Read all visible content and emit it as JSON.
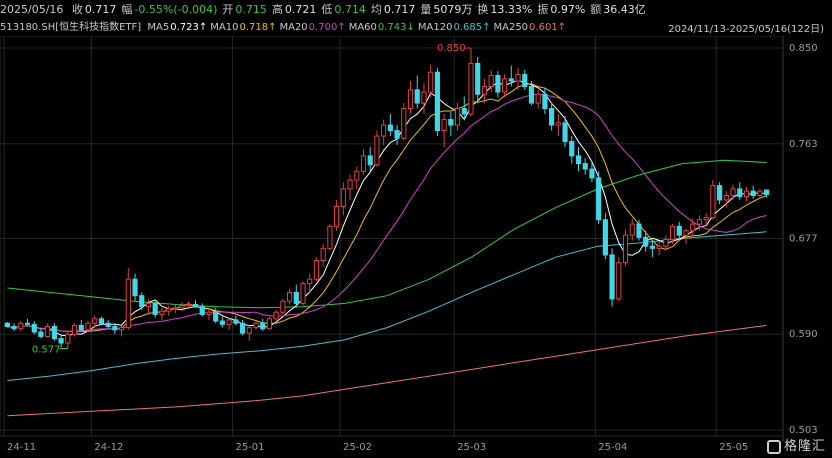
{
  "header": {
    "date": "2025/05/16",
    "items": [
      {
        "label": "收",
        "value": "0.717",
        "color": "#e0e0e0"
      },
      {
        "label": "幅",
        "value": "-0.55%(-0.004)",
        "color": "#2ecc40"
      },
      {
        "label": "开",
        "value": "0.715",
        "color": "#2ecc40"
      },
      {
        "label": "高",
        "value": "0.721",
        "color": "#e0e0e0"
      },
      {
        "label": "低",
        "value": "0.714",
        "color": "#2ecc40"
      },
      {
        "label": "均",
        "value": "0.717",
        "color": "#e0e0e0"
      },
      {
        "label": "量",
        "value": "5079万",
        "color": "#e0e0e0"
      },
      {
        "label": "换",
        "value": "13.33%",
        "color": "#e0e0e0"
      },
      {
        "label": "振",
        "value": "0.97%",
        "color": "#e0e0e0"
      },
      {
        "label": "额",
        "value": "36.43亿",
        "color": "#e0e0e0"
      }
    ]
  },
  "ma_bar": {
    "security": "513180.SH[恒生科技指数ETF]",
    "period": "2024/11/13-2025/05/16(122日)",
    "items": [
      {
        "label": "MA5",
        "value": "0.723↑",
        "color": "#ffffff"
      },
      {
        "label": "MA10",
        "value": "0.718↑",
        "color": "#f0c000"
      },
      {
        "label": "MA20",
        "value": "0.700↑",
        "color": "#d040d0"
      },
      {
        "label": "MA60",
        "value": "0.743↓",
        "color": "#2ecc40"
      },
      {
        "label": "MA120",
        "value": "0.685↑",
        "color": "#40c0d0"
      },
      {
        "label": "MA250",
        "value": "0.601↑",
        "color": "#f07070"
      }
    ]
  },
  "logo": {
    "text": "格隆汇"
  },
  "chart_data": {
    "type": "candlestick",
    "y_ticks": [
      "0.850",
      "0.763",
      "0.677",
      "0.590",
      "0.503"
    ],
    "ylim": [
      0.503,
      0.85
    ],
    "x_ticks": [
      {
        "label": "24-11",
        "i": 0
      },
      {
        "label": "24-12",
        "i": 13
      },
      {
        "label": "25-01",
        "i": 34
      },
      {
        "label": "25-02",
        "i": 50
      },
      {
        "label": "25-03",
        "i": 67
      },
      {
        "label": "25-04",
        "i": 88
      },
      {
        "label": "25-05",
        "i": 106
      }
    ],
    "annotations": [
      {
        "text": "0.850",
        "i": 69,
        "value": 0.85
      },
      {
        "text": "0.577",
        "i": 9,
        "value": 0.577
      }
    ],
    "ohlc": [
      [
        0.6,
        0.601,
        0.596,
        0.597
      ],
      [
        0.597,
        0.6,
        0.593,
        0.595
      ],
      [
        0.595,
        0.602,
        0.593,
        0.6
      ],
      [
        0.6,
        0.604,
        0.597,
        0.599
      ],
      [
        0.599,
        0.602,
        0.59,
        0.592
      ],
      [
        0.592,
        0.596,
        0.586,
        0.588
      ],
      [
        0.588,
        0.6,
        0.587,
        0.597
      ],
      [
        0.597,
        0.6,
        0.584,
        0.586
      ],
      [
        0.586,
        0.59,
        0.578,
        0.582
      ],
      [
        0.582,
        0.592,
        0.577,
        0.59
      ],
      [
        0.59,
        0.6,
        0.588,
        0.598
      ],
      [
        0.598,
        0.603,
        0.592,
        0.594
      ],
      [
        0.594,
        0.602,
        0.592,
        0.6
      ],
      [
        0.6,
        0.607,
        0.596,
        0.604
      ],
      [
        0.604,
        0.606,
        0.598,
        0.6
      ],
      [
        0.6,
        0.603,
        0.595,
        0.597
      ],
      [
        0.597,
        0.6,
        0.59,
        0.594
      ],
      [
        0.594,
        0.598,
        0.588,
        0.596
      ],
      [
        0.596,
        0.65,
        0.594,
        0.64
      ],
      [
        0.64,
        0.645,
        0.62,
        0.625
      ],
      [
        0.625,
        0.628,
        0.612,
        0.615
      ],
      [
        0.615,
        0.622,
        0.608,
        0.618
      ],
      [
        0.618,
        0.62,
        0.605,
        0.608
      ],
      [
        0.608,
        0.614,
        0.603,
        0.611
      ],
      [
        0.611,
        0.616,
        0.607,
        0.613
      ],
      [
        0.613,
        0.617,
        0.609,
        0.614
      ],
      [
        0.614,
        0.619,
        0.611,
        0.616
      ],
      [
        0.616,
        0.62,
        0.613,
        0.617
      ],
      [
        0.617,
        0.621,
        0.614,
        0.615
      ],
      [
        0.615,
        0.618,
        0.606,
        0.608
      ],
      [
        0.608,
        0.613,
        0.603,
        0.61
      ],
      [
        0.61,
        0.614,
        0.6,
        0.602
      ],
      [
        0.602,
        0.606,
        0.596,
        0.599
      ],
      [
        0.599,
        0.605,
        0.594,
        0.603
      ],
      [
        0.603,
        0.607,
        0.598,
        0.6
      ],
      [
        0.6,
        0.603,
        0.589,
        0.591
      ],
      [
        0.591,
        0.598,
        0.584,
        0.596
      ],
      [
        0.596,
        0.602,
        0.594,
        0.6
      ],
      [
        0.6,
        0.604,
        0.593,
        0.595
      ],
      [
        0.595,
        0.606,
        0.594,
        0.604
      ],
      [
        0.604,
        0.612,
        0.601,
        0.61
      ],
      [
        0.61,
        0.622,
        0.608,
        0.62
      ],
      [
        0.62,
        0.631,
        0.617,
        0.628
      ],
      [
        0.628,
        0.635,
        0.614,
        0.618
      ],
      [
        0.618,
        0.638,
        0.616,
        0.636
      ],
      [
        0.636,
        0.645,
        0.628,
        0.64
      ],
      [
        0.64,
        0.66,
        0.638,
        0.657
      ],
      [
        0.657,
        0.672,
        0.652,
        0.668
      ],
      [
        0.668,
        0.69,
        0.666,
        0.688
      ],
      [
        0.688,
        0.712,
        0.684,
        0.706
      ],
      [
        0.706,
        0.728,
        0.698,
        0.722
      ],
      [
        0.722,
        0.735,
        0.712,
        0.73
      ],
      [
        0.73,
        0.742,
        0.722,
        0.738
      ],
      [
        0.738,
        0.758,
        0.735,
        0.752
      ],
      [
        0.752,
        0.76,
        0.738,
        0.744
      ],
      [
        0.744,
        0.775,
        0.742,
        0.77
      ],
      [
        0.77,
        0.785,
        0.762,
        0.78
      ],
      [
        0.78,
        0.79,
        0.77,
        0.775
      ],
      [
        0.775,
        0.78,
        0.762,
        0.768
      ],
      [
        0.768,
        0.8,
        0.766,
        0.795
      ],
      [
        0.795,
        0.82,
        0.79,
        0.812
      ],
      [
        0.812,
        0.825,
        0.795,
        0.8
      ],
      [
        0.8,
        0.818,
        0.79,
        0.81
      ],
      [
        0.81,
        0.835,
        0.805,
        0.828
      ],
      [
        0.828,
        0.832,
        0.77,
        0.775
      ],
      [
        0.775,
        0.79,
        0.76,
        0.785
      ],
      [
        0.785,
        0.792,
        0.77,
        0.78
      ],
      [
        0.78,
        0.8,
        0.775,
        0.795
      ],
      [
        0.795,
        0.806,
        0.785,
        0.79
      ],
      [
        0.79,
        0.85,
        0.788,
        0.836
      ],
      [
        0.836,
        0.842,
        0.8,
        0.808
      ],
      [
        0.808,
        0.822,
        0.8,
        0.815
      ],
      [
        0.815,
        0.83,
        0.81,
        0.825
      ],
      [
        0.825,
        0.829,
        0.805,
        0.81
      ],
      [
        0.81,
        0.826,
        0.805,
        0.822
      ],
      [
        0.822,
        0.834,
        0.815,
        0.82
      ],
      [
        0.82,
        0.832,
        0.812,
        0.826
      ],
      [
        0.826,
        0.83,
        0.812,
        0.815
      ],
      [
        0.815,
        0.82,
        0.798,
        0.8
      ],
      [
        0.8,
        0.812,
        0.795,
        0.808
      ],
      [
        0.808,
        0.814,
        0.79,
        0.795
      ],
      [
        0.795,
        0.8,
        0.775,
        0.78
      ],
      [
        0.78,
        0.79,
        0.77,
        0.782
      ],
      [
        0.782,
        0.788,
        0.76,
        0.765
      ],
      [
        0.765,
        0.77,
        0.745,
        0.752
      ],
      [
        0.752,
        0.76,
        0.738,
        0.745
      ],
      [
        0.745,
        0.75,
        0.735,
        0.74
      ],
      [
        0.74,
        0.746,
        0.728,
        0.732
      ],
      [
        0.732,
        0.738,
        0.69,
        0.694
      ],
      [
        0.694,
        0.7,
        0.658,
        0.662
      ],
      [
        0.662,
        0.668,
        0.615,
        0.622
      ],
      [
        0.622,
        0.66,
        0.62,
        0.655
      ],
      [
        0.655,
        0.685,
        0.652,
        0.68
      ],
      [
        0.68,
        0.695,
        0.675,
        0.69
      ],
      [
        0.69,
        0.694,
        0.675,
        0.678
      ],
      [
        0.678,
        0.684,
        0.665,
        0.67
      ],
      [
        0.67,
        0.676,
        0.66,
        0.668
      ],
      [
        0.668,
        0.674,
        0.662,
        0.67
      ],
      [
        0.67,
        0.68,
        0.666,
        0.676
      ],
      [
        0.676,
        0.69,
        0.672,
        0.688
      ],
      [
        0.688,
        0.692,
        0.676,
        0.68
      ],
      [
        0.68,
        0.686,
        0.672,
        0.684
      ],
      [
        0.684,
        0.695,
        0.68,
        0.69
      ],
      [
        0.69,
        0.698,
        0.684,
        0.694
      ],
      [
        0.694,
        0.7,
        0.688,
        0.696
      ],
      [
        0.696,
        0.73,
        0.694,
        0.725
      ],
      [
        0.725,
        0.728,
        0.708,
        0.712
      ],
      [
        0.712,
        0.72,
        0.705,
        0.716
      ],
      [
        0.716,
        0.726,
        0.712,
        0.722
      ],
      [
        0.722,
        0.728,
        0.712,
        0.715
      ],
      [
        0.715,
        0.724,
        0.711,
        0.72
      ],
      [
        0.72,
        0.725,
        0.713,
        0.716
      ],
      [
        0.716,
        0.722,
        0.713,
        0.72
      ],
      [
        0.721,
        0.721,
        0.714,
        0.717
      ]
    ],
    "ma_series": [
      {
        "name": "MA5",
        "color": "#ffffff",
        "window": 5
      },
      {
        "name": "MA10",
        "color": "#f0c000",
        "window": 10
      },
      {
        "name": "MA20",
        "color": "#d040d0",
        "window": 20
      }
    ],
    "long_ma_series": [
      {
        "name": "MA60",
        "color": "#2ecc40",
        "values": [
          0.632,
          0.628,
          0.624,
          0.62,
          0.617,
          0.615,
          0.614,
          0.615,
          0.618,
          0.625,
          0.64,
          0.66,
          0.685,
          0.705,
          0.722,
          0.735,
          0.745,
          0.748,
          0.746
        ]
      },
      {
        "name": "MA120",
        "color": "#40c0d0",
        "values": [
          0.548,
          0.552,
          0.557,
          0.563,
          0.568,
          0.572,
          0.575,
          0.579,
          0.585,
          0.596,
          0.611,
          0.628,
          0.644,
          0.66,
          0.67,
          0.673,
          0.677,
          0.68,
          0.683
        ]
      },
      {
        "name": "MA250",
        "color": "#f07070",
        "values": [
          0.516,
          0.518,
          0.52,
          0.522,
          0.524,
          0.527,
          0.53,
          0.534,
          0.54,
          0.546,
          0.552,
          0.558,
          0.564,
          0.57,
          0.576,
          0.582,
          0.588,
          0.593,
          0.598
        ]
      }
    ],
    "colors": {
      "up": "#e04040",
      "down": "#40d8e8",
      "grid": "#262626",
      "axis": "#9a9a9a"
    }
  }
}
